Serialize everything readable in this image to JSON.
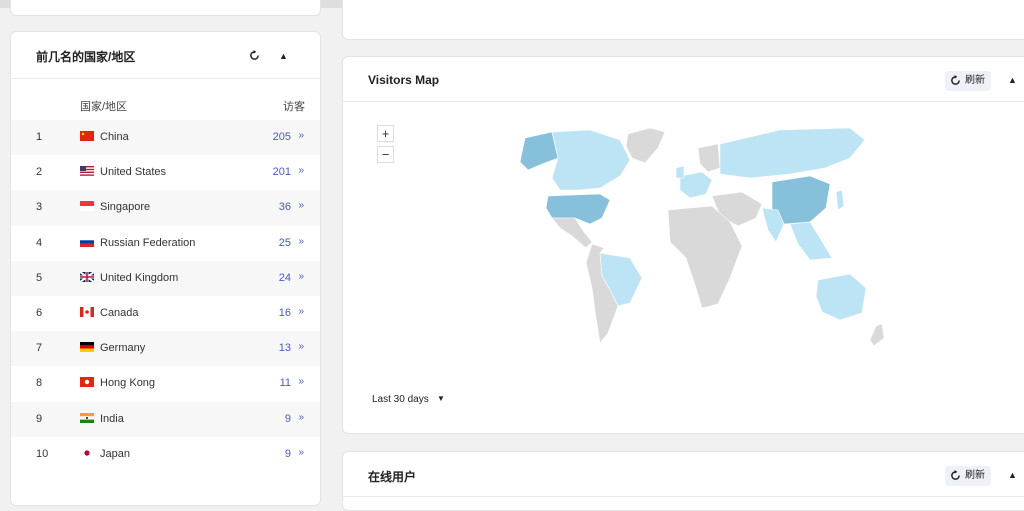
{
  "top_countries": {
    "title": "前几名的国家/地区",
    "col_country": "国家/地区",
    "col_visitors": "访客",
    "rows": [
      {
        "rank": "1",
        "name": "China",
        "count": "205",
        "flag": "cn"
      },
      {
        "rank": "2",
        "name": "United States",
        "count": "201",
        "flag": "us"
      },
      {
        "rank": "3",
        "name": "Singapore",
        "count": "36",
        "flag": "sg"
      },
      {
        "rank": "4",
        "name": "Russian Federation",
        "count": "25",
        "flag": "ru"
      },
      {
        "rank": "5",
        "name": "United Kingdom",
        "count": "24",
        "flag": "gb"
      },
      {
        "rank": "6",
        "name": "Canada",
        "count": "16",
        "flag": "ca"
      },
      {
        "rank": "7",
        "name": "Germany",
        "count": "13",
        "flag": "de"
      },
      {
        "rank": "8",
        "name": "Hong Kong",
        "count": "11",
        "flag": "hk"
      },
      {
        "rank": "9",
        "name": "India",
        "count": "9",
        "flag": "in"
      },
      {
        "rank": "10",
        "name": "Japan",
        "count": "9",
        "flag": "jp"
      }
    ]
  },
  "visitors_map": {
    "title": "Visitors Map",
    "refresh_label": "刷新",
    "zoom_in": "+",
    "zoom_out": "−",
    "range_label": "Last 30 days"
  },
  "online_users": {
    "title": "在线用户",
    "refresh_label": "刷新"
  },
  "colors": {
    "link": "#4a59c8",
    "map_high": "#86c0db",
    "map_low": "#bde4f5",
    "map_none": "#d9d9d9"
  }
}
